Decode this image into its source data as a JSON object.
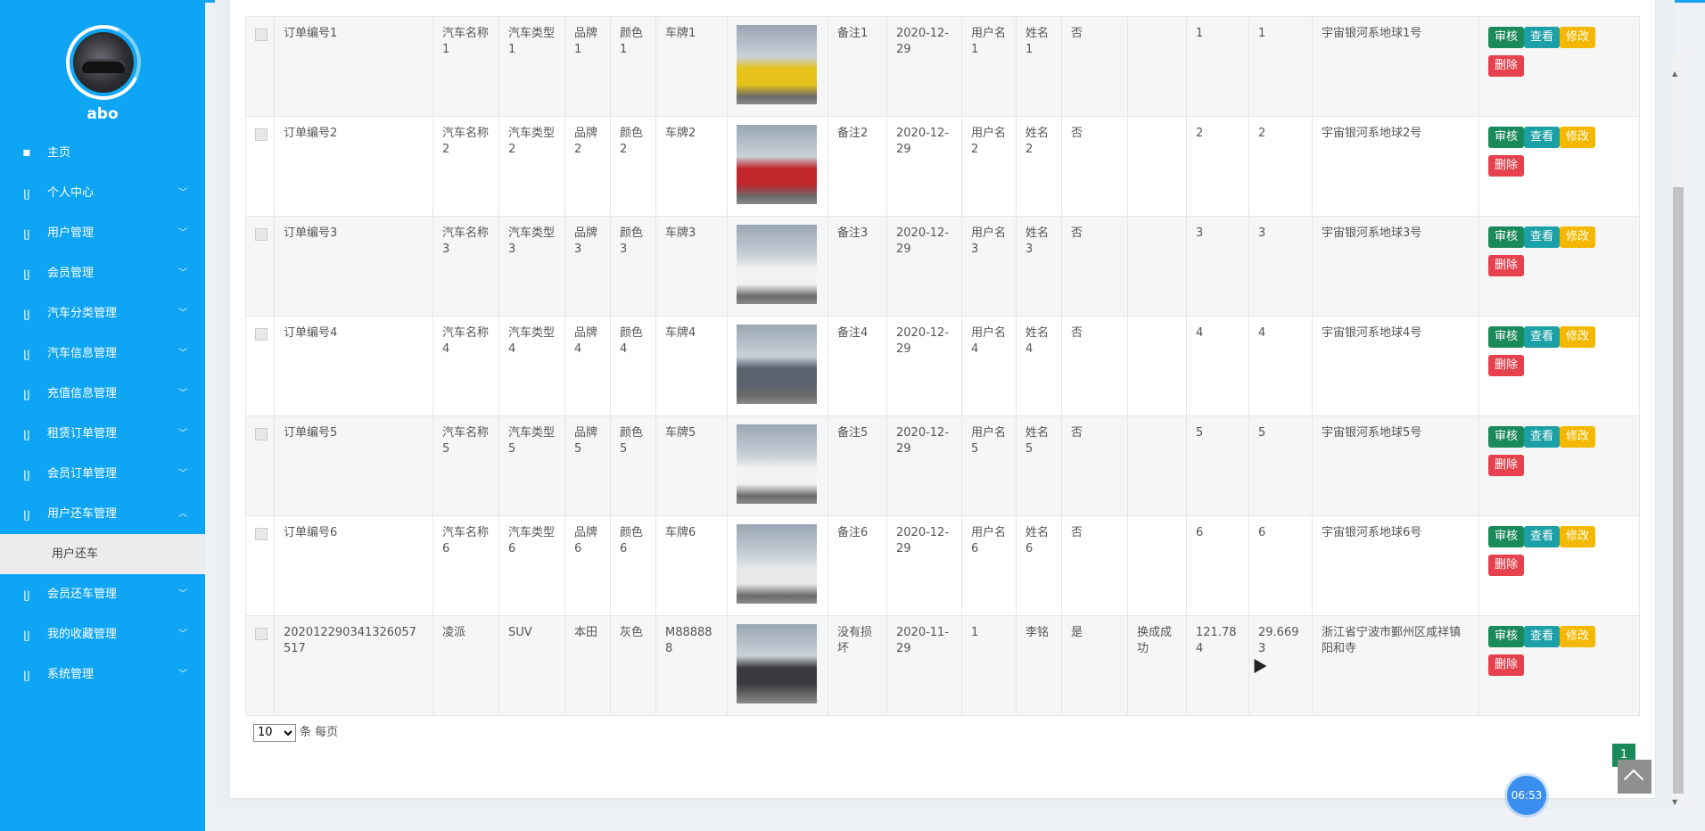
{
  "user": {
    "name": "abo"
  },
  "nav": [
    {
      "label": "主页",
      "icon": "home-icon",
      "expandable": false
    },
    {
      "label": "个人中心",
      "icon": "stethoscope-icon",
      "expandable": true
    },
    {
      "label": "用户管理",
      "icon": "stethoscope-icon",
      "expandable": true
    },
    {
      "label": "会员管理",
      "icon": "stethoscope-icon",
      "expandable": true
    },
    {
      "label": "汽车分类管理",
      "icon": "stethoscope-icon",
      "expandable": true
    },
    {
      "label": "汽车信息管理",
      "icon": "stethoscope-icon",
      "expandable": true
    },
    {
      "label": "充值信息管理",
      "icon": "stethoscope-icon",
      "expandable": true
    },
    {
      "label": "租赁订单管理",
      "icon": "stethoscope-icon",
      "expandable": true
    },
    {
      "label": "会员订单管理",
      "icon": "stethoscope-icon",
      "expandable": true
    },
    {
      "label": "用户还车管理",
      "icon": "stethoscope-icon",
      "expandable": true,
      "expanded": true
    }
  ],
  "nav_sub": {
    "label": "用户还车"
  },
  "nav_after": [
    {
      "label": "会员还车管理",
      "icon": "stethoscope-icon",
      "expandable": true
    },
    {
      "label": "我的收藏管理",
      "icon": "stethoscope-icon",
      "expandable": true
    },
    {
      "label": "系统管理",
      "icon": "stethoscope-icon",
      "expandable": true
    }
  ],
  "rows": [
    {
      "order_no": "订单编号1",
      "car_name": "汽车名称1",
      "car_type": "汽车类型1",
      "brand": "品牌1",
      "color": "颜色1",
      "plate": "车牌1",
      "remark": "备注1",
      "date": "2020-12-29",
      "username": "用户名1",
      "realname": "姓名1",
      "flag": "否",
      "status": "",
      "v1": "1",
      "v2": "1",
      "address": "宇宙银河系地球1号",
      "photo_color": "#e6c21a"
    },
    {
      "order_no": "订单编号2",
      "car_name": "汽车名称2",
      "car_type": "汽车类型2",
      "brand": "品牌2",
      "color": "颜色2",
      "plate": "车牌2",
      "remark": "备注2",
      "date": "2020-12-29",
      "username": "用户名2",
      "realname": "姓名2",
      "flag": "否",
      "status": "",
      "v1": "2",
      "v2": "2",
      "address": "宇宙银河系地球2号",
      "photo_color": "#c0262a"
    },
    {
      "order_no": "订单编号3",
      "car_name": "汽车名称3",
      "car_type": "汽车类型3",
      "brand": "品牌3",
      "color": "颜色3",
      "plate": "车牌3",
      "remark": "备注3",
      "date": "2020-12-29",
      "username": "用户名3",
      "realname": "姓名3",
      "flag": "否",
      "status": "",
      "v1": "3",
      "v2": "3",
      "address": "宇宙银河系地球3号",
      "photo_color": "#f2f2f2"
    },
    {
      "order_no": "订单编号4",
      "car_name": "汽车名称4",
      "car_type": "汽车类型4",
      "brand": "品牌4",
      "color": "颜色4",
      "plate": "车牌4",
      "remark": "备注4",
      "date": "2020-12-29",
      "username": "用户名4",
      "realname": "姓名4",
      "flag": "否",
      "status": "",
      "v1": "4",
      "v2": "4",
      "address": "宇宙银河系地球4号",
      "photo_color": "#5a6270"
    },
    {
      "order_no": "订单编号5",
      "car_name": "汽车名称5",
      "car_type": "汽车类型5",
      "brand": "品牌5",
      "color": "颜色5",
      "plate": "车牌5",
      "remark": "备注5",
      "date": "2020-12-29",
      "username": "用户名5",
      "realname": "姓名5",
      "flag": "否",
      "status": "",
      "v1": "5",
      "v2": "5",
      "address": "宇宙银河系地球5号",
      "photo_color": "#f2f2f2"
    },
    {
      "order_no": "订单编号6",
      "car_name": "汽车名称6",
      "car_type": "汽车类型6",
      "brand": "品牌6",
      "color": "颜色6",
      "plate": "车牌6",
      "remark": "备注6",
      "date": "2020-12-29",
      "username": "用户名6",
      "realname": "姓名6",
      "flag": "否",
      "status": "",
      "v1": "6",
      "v2": "6",
      "address": "宇宙银河系地球6号",
      "photo_color": "#e8e8ea"
    },
    {
      "order_no": "20201229034132605751​7",
      "car_name": "凌派",
      "car_type": "SUV",
      "brand": "本田",
      "color": "灰色",
      "plate": "M888888",
      "remark": "没有损坏",
      "date": "2020-11-29",
      "username": "1",
      "realname": "李铭",
      "flag": "是",
      "status": "换成成功",
      "v1": "121.784",
      "v2": "29.6693",
      "address": "浙江省宁波市鄞州区咸祥镇阳和寺",
      "photo_color": "#3a3b3f"
    }
  ],
  "actions": {
    "approve": "审核",
    "view": "查看",
    "edit": "修改",
    "delete": "删除"
  },
  "colors": {
    "sidebar": "#0ea5f4",
    "approve": "#1b8a5a",
    "view": "#1aa0a6",
    "edit": "#f5b800",
    "delete": "#e7414d"
  },
  "pager": {
    "page_size": "10",
    "suffix": "条 每页",
    "current_page": "1"
  },
  "clock": {
    "time": "06:53"
  }
}
